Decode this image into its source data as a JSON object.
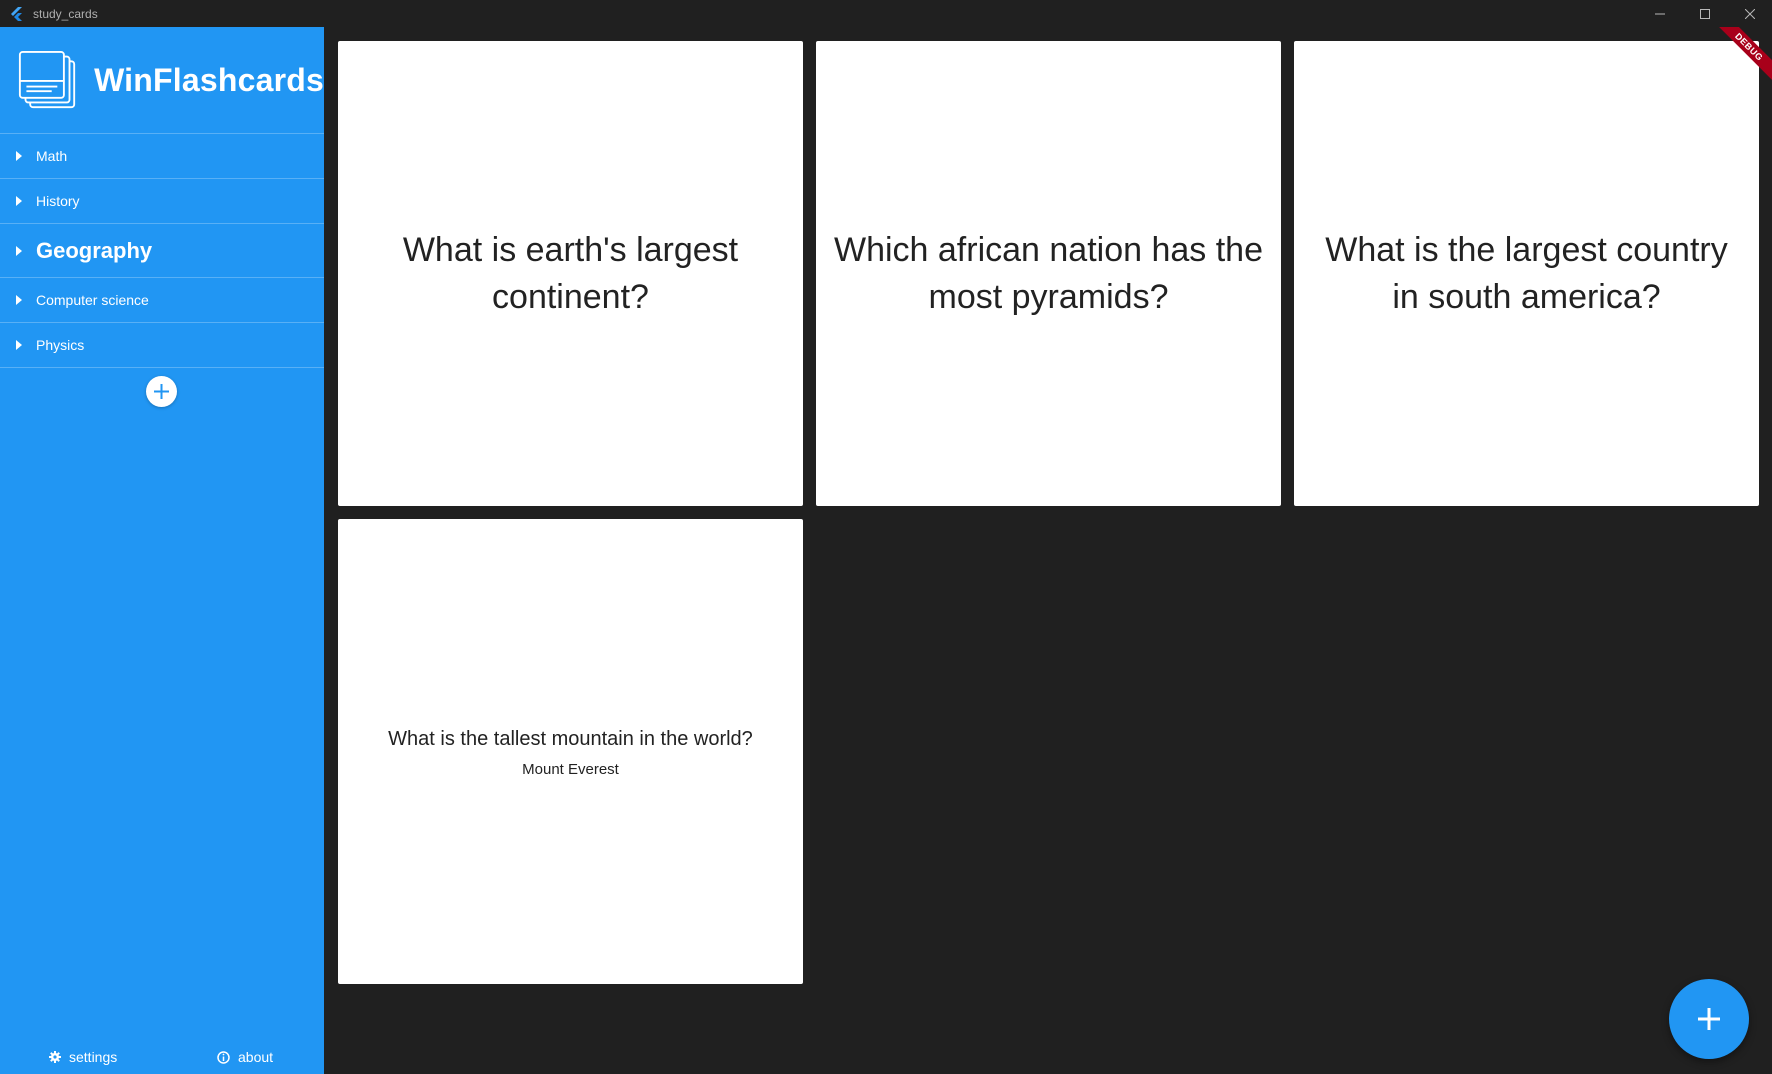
{
  "window": {
    "title": "study_cards"
  },
  "sidebar": {
    "brand": "WinFlashcards",
    "decks": [
      {
        "label": "Math",
        "selected": false
      },
      {
        "label": "History",
        "selected": false
      },
      {
        "label": "Geography",
        "selected": true
      },
      {
        "label": "Computer science",
        "selected": false
      },
      {
        "label": "Physics",
        "selected": false
      }
    ],
    "footer": {
      "settings_label": "settings",
      "about_label": "about"
    }
  },
  "cards": [
    {
      "question": "What is earth's largest continent?",
      "answer": ""
    },
    {
      "question": "Which african nation has the most pyramids?",
      "answer": ""
    },
    {
      "question": "What is the largest country in south america?",
      "answer": ""
    },
    {
      "question": "What is the tallest mountain in the world?",
      "answer": "Mount Everest"
    }
  ],
  "debug_banner": "DEBUG",
  "colors": {
    "accent": "#2196f3",
    "background": "#202020",
    "card": "#ffffff",
    "debug": "#a8001a"
  },
  "icons": {
    "app": "flutter-icon",
    "logo": "flashcards-stack-icon",
    "settings": "gear-icon",
    "about": "info-icon",
    "add": "plus-icon"
  }
}
